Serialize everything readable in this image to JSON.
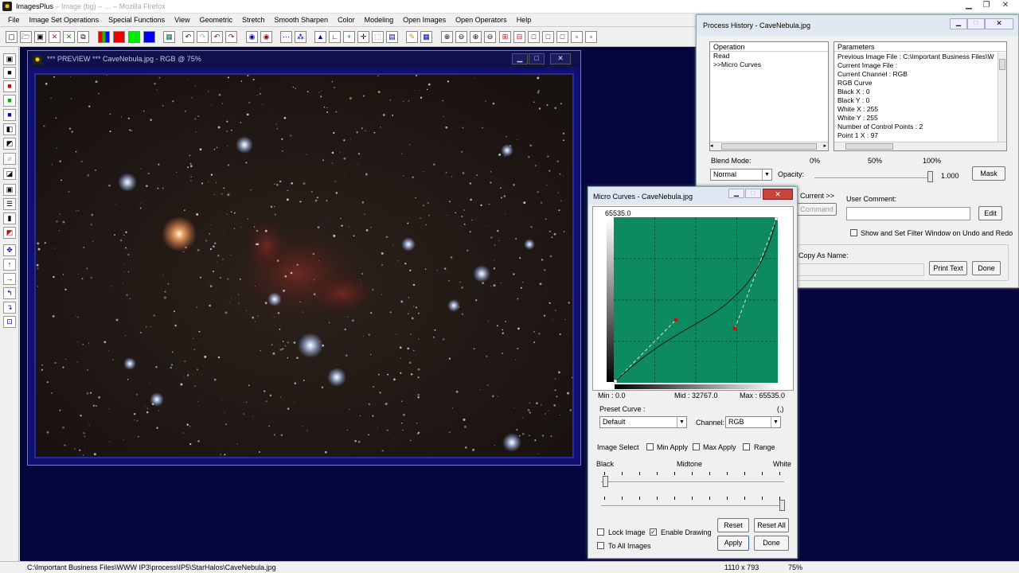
{
  "app": {
    "title": "ImagesPlus",
    "title_faded": "– Image (bg) – … – Mozilla Firefox",
    "menu": [
      "File",
      "Image Set Operations",
      "Special Functions",
      "View",
      "Geometric",
      "Stretch",
      "Smooth Sharpen",
      "Color",
      "Modeling",
      "Open Images",
      "Open Operators",
      "Help"
    ]
  },
  "preview": {
    "title": "*** PREVIEW *** CaveNebula.jpg - RGB @ 75%"
  },
  "history": {
    "title": "Process History - CaveNebula.jpg",
    "operation_header": "Operation",
    "operations": [
      "Read",
      ">>Micro Curves"
    ],
    "parameters_header": "Parameters",
    "parameters": [
      "Previous Image File : C:\\Important Business Files\\W",
      "Current Image File :",
      "Current Channel : RGB",
      "RGB Curve",
      " Black X : 0",
      " Black Y : 0",
      " White X : 255",
      " White Y : 255",
      " Number of Control Points : 2",
      " Point 1 X : 97"
    ],
    "blend_mode_label": "Blend Mode:",
    "blend_mode_value": "Normal",
    "opacity_label": "Opacity:",
    "pct_0": "0%",
    "pct_50": "50%",
    "pct_100": "100%",
    "opacity_value": "1.000",
    "mask_label": "Mask",
    "current_label": "Current >>",
    "command_label": "Command",
    "user_comment_label": "User Comment:",
    "edit_label": "Edit",
    "show_filter_label": "Show and Set Filter Window on Undo and Redo",
    "copy_as_name_label": "Copy As Name:",
    "print_text_label": "Print Text",
    "done_label": "Done"
  },
  "curves": {
    "title": "Micro Curves - CaveNebula.jpg",
    "top_value": "65535.0",
    "min_label": "Min :  0.0",
    "mid_label": "Mid :  32767.0",
    "max_label": "Max :  65535.0",
    "preset_label": "Preset Curve :",
    "paren": "(,)",
    "preset_value": "Default",
    "channel_label": "Channel:",
    "channel_value": "RGB",
    "image_select_label": "Image Select",
    "min_apply": "Min Apply",
    "max_apply": "Max Apply",
    "range": "Range",
    "black": "Black",
    "midtone": "Midtone",
    "white": "White",
    "reset": "Reset",
    "reset_all": "Reset All",
    "lock_image": "Lock Image",
    "enable_drawing": "Enable Drawing",
    "to_all_images": "To All Images",
    "apply": "Apply",
    "done": "Done",
    "colors": {
      "grid_bg": "#0e8a60",
      "curve": "#0b1a10",
      "point": "#d01010"
    }
  },
  "status": {
    "path": "C:\\Important Business Files\\WWW IP3\\process\\IP5\\StarHalos\\CaveNebula.jpg",
    "size": "1110 x 793",
    "zoom": "75%"
  }
}
